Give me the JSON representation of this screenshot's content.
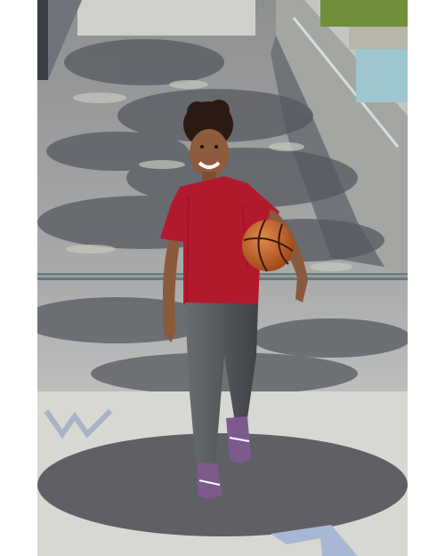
{
  "photo": {
    "subject": "child-walking-with-basketball",
    "colors": {
      "background": "#ffffff",
      "pavement_light": "#dcdcd8",
      "pavement_shadow": "#5f6066",
      "wall": "#9a9d98",
      "shirt": "#b3192d",
      "leggings": "#55585a",
      "shoes": "#7d5a8c",
      "skin": "#8a5a3c",
      "hair": "#2a1a12",
      "basketball": "#c8652b",
      "water": "#9ec6cf",
      "trees": "#6f8f3a"
    }
  }
}
